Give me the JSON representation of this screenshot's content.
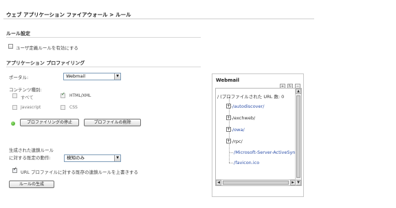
{
  "header": {
    "breadcrumb": "ウェブ アプリケーション ファイアウォール > ルール"
  },
  "rule_settings": {
    "title": "ルール設定",
    "enable_user_rules_label": "ユーザ定義ルールを有効にする",
    "enable_user_rules_checked": false
  },
  "profiling": {
    "title": "アプリケーション プロファイリング",
    "portal_label": "ポータル:",
    "portal_value": "Webmail",
    "content_type_label": "コンテンツ種別:",
    "content_types": [
      {
        "label": "すべて",
        "checked": false,
        "enabled": false
      },
      {
        "label": "HTML/XML",
        "checked": true,
        "enabled": false
      },
      {
        "label": "Javascript",
        "checked": false,
        "enabled": false
      },
      {
        "label": "CSS",
        "checked": false,
        "enabled": false
      }
    ],
    "status_color": "#2f9a13",
    "stop_button": "プロファイリングの停止",
    "delete_button": "プロファイルの削除",
    "generated_rules_label_line1": "生成された連鎖ルール",
    "generated_rules_label_line2": "に対する既定の動作:",
    "action_value": "検知のみ",
    "overwrite_label": "URL プロファイルに対する既存の連鎖ルールを上書きする",
    "overwrite_checked": true,
    "generate_button": "ルールの生成"
  },
  "tree_panel": {
    "title": "Webmail",
    "toolbar_icons": [
      "expand-all-icon",
      "refresh-icon",
      "collapse-all-icon"
    ],
    "root_label": "/ (プロファイルされた URL 数: 0",
    "nodes": [
      {
        "label": "/autodiscover/",
        "expandable": true,
        "link": true
      },
      {
        "label": "/exchweb/",
        "expandable": true,
        "link": false
      },
      {
        "label": "/owa/",
        "expandable": true,
        "link": true
      },
      {
        "label": "/rpc/",
        "expandable": true,
        "link": false
      },
      {
        "label": "/Microsoft-Server-ActiveSync",
        "expandable": false,
        "link": true
      },
      {
        "label": "/favicon.ico",
        "expandable": false,
        "link": true
      }
    ]
  }
}
